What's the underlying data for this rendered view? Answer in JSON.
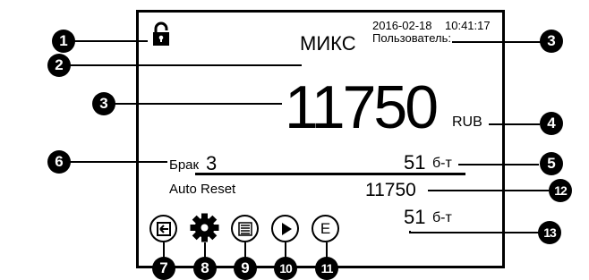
{
  "status": {
    "date": "2016-02-18",
    "time": "10:41:17",
    "user_label": "Пользователь:",
    "lock_icon": "lock-icon"
  },
  "mode": {
    "label": "МИКС"
  },
  "total": {
    "amount": "11750",
    "currency": "RUB"
  },
  "reject": {
    "label": "Брак",
    "count": "3"
  },
  "pieces": {
    "count": "51",
    "unit": "б-т"
  },
  "auto_reset": {
    "label": "Auto Reset",
    "amount": "11750",
    "count": "51",
    "unit": "б-т"
  },
  "toolbar": {
    "icons": [
      "exit-icon",
      "gear-icon",
      "menu-list-icon",
      "play-icon",
      "e-icon"
    ],
    "e_label": "E"
  },
  "callouts": {
    "c1": "1",
    "c2": "2",
    "c3a": "3",
    "c3b": "3",
    "c4": "4",
    "c5": "5",
    "c6": "6",
    "c7": "7",
    "c8": "8",
    "c9": "9",
    "c10": "10",
    "c11": "11",
    "c12": "12",
    "c13": "13"
  }
}
